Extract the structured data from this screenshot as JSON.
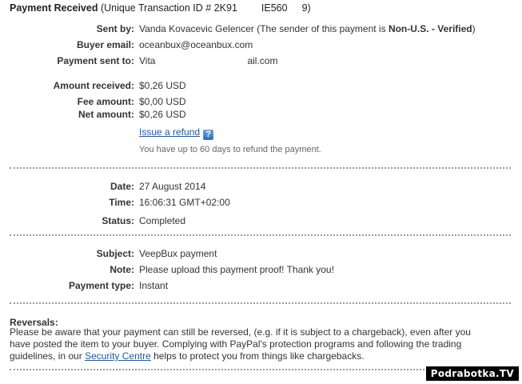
{
  "header": {
    "title": "Payment Received",
    "txn_prefix": "(Unique Transaction ID # 2K91",
    "txn_mid": "IE560",
    "txn_end": "9)"
  },
  "sender": {
    "sent_by_label": "Sent by:",
    "sent_by_value": "Vanda Kovacevic Gelencer (The sender of this payment is ",
    "sender_status": "Non-U.S. - Verified",
    "sent_by_close": ")",
    "buyer_email_label": "Buyer email:",
    "buyer_email_value": "oceanbux@oceanbux.com",
    "sent_to_label": "Payment sent to:",
    "sent_to_prefix": "Vita",
    "sent_to_suffix": "ail.com"
  },
  "amounts": {
    "received_label": "Amount received:",
    "received_value": "$0,26 USD",
    "fee_label": "Fee amount:",
    "fee_value": "$0,00 USD",
    "net_label": "Net amount:",
    "net_value": "$0,26 USD",
    "refund_link": "Issue a refund",
    "help_icon": "?",
    "refund_note": "You have up to 60 days to refund the payment."
  },
  "details": {
    "date_label": "Date:",
    "date_value": "27 August 2014",
    "time_label": "Time:",
    "time_value": "16:06:31 GMT+02:00",
    "status_label": "Status:",
    "status_value": "Completed"
  },
  "message": {
    "subject_label": "Subject:",
    "subject_value": "VeepBux payment",
    "note_label": "Note:",
    "note_value": "Please upload this payment proof! Thank you!",
    "type_label": "Payment type:",
    "type_value": "Instant"
  },
  "reversals": {
    "heading": "Reversals:",
    "text_part1": "Please be aware that your payment can still be reversed, (e.g. if it is subject to a chargeback), even after you have posted the item to your buyer. Complying with PayPal's protection programs and following the trading guidelines, in our ",
    "link": "Security Centre",
    "text_part2": " helps to protect you from things like chargebacks."
  },
  "watermark": "Podrabotka.TV"
}
